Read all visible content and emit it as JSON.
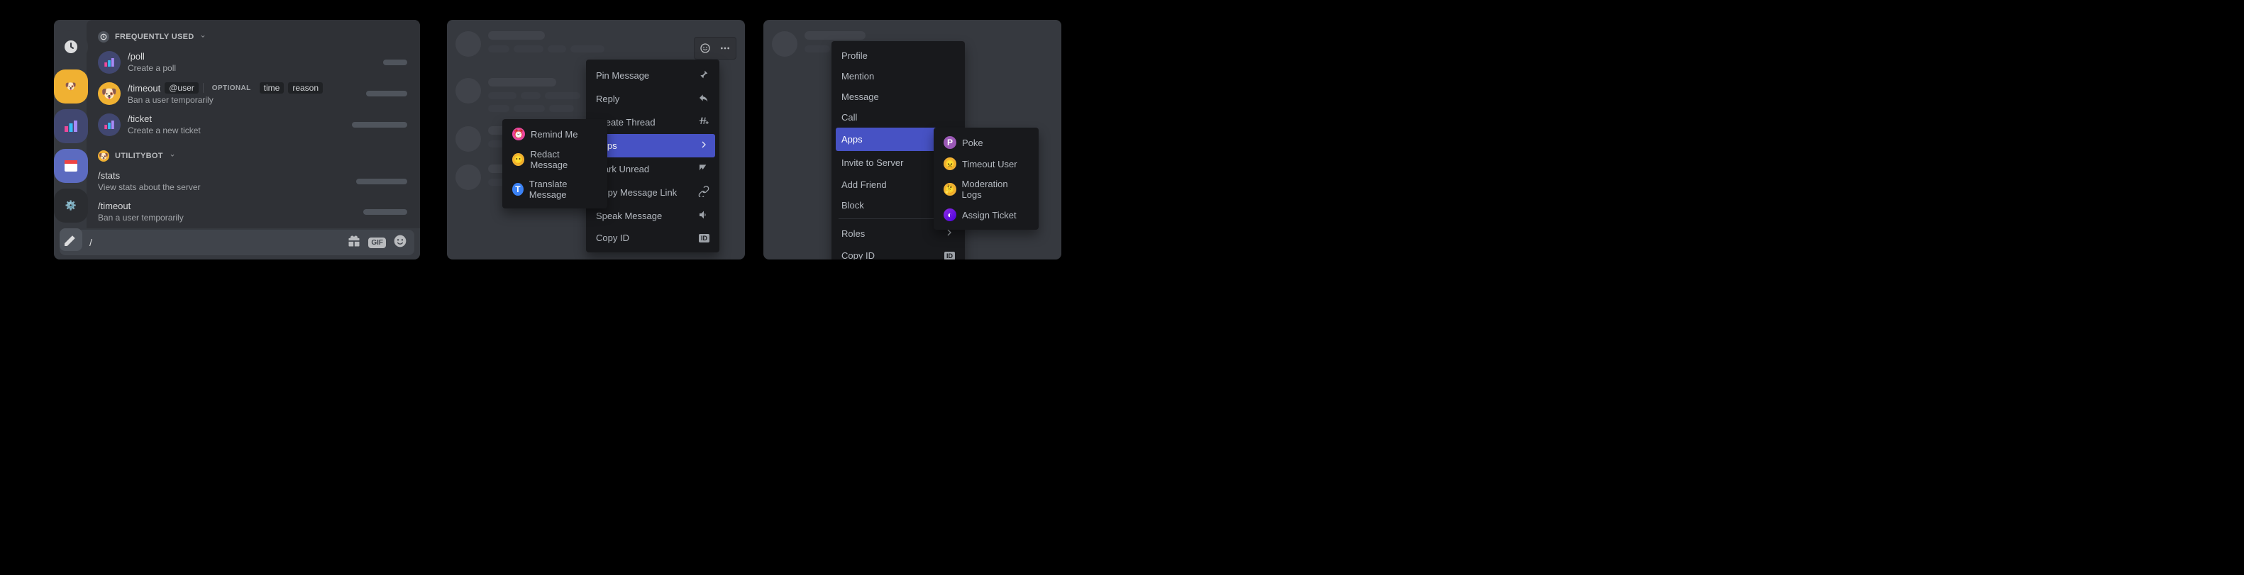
{
  "panel1": {
    "server_rail": [
      "clock",
      "dog",
      "chart",
      "window",
      "gear",
      "pencil"
    ],
    "section1": {
      "header": "FREQUENTLY USED",
      "commands": [
        {
          "icon": "chart",
          "name": "/poll",
          "desc": "Create a poll"
        },
        {
          "icon": "dog",
          "name": "/timeout",
          "args": [
            "@user"
          ],
          "optional_label": "OPTIONAL",
          "optional": [
            "time",
            "reason"
          ],
          "desc": "Ban a user temporarily"
        },
        {
          "icon": "chart",
          "name": "/ticket",
          "desc": "Create a new ticket"
        }
      ]
    },
    "section2": {
      "header": "UTILITYBOT",
      "commands": [
        {
          "name": "/stats",
          "desc": "View stats about the server"
        },
        {
          "name": "/timeout",
          "desc": "Ban a user temporarily"
        }
      ]
    },
    "input": {
      "value": "/",
      "right_icons": [
        "gift",
        "gif",
        "emoji"
      ],
      "gif_label": "GIF"
    }
  },
  "panel2": {
    "hover_icons": [
      "emoji",
      "more"
    ],
    "context_menu": [
      {
        "label": "Pin Message",
        "icon": "pin"
      },
      {
        "label": "Reply",
        "icon": "reply"
      },
      {
        "label": "Create Thread",
        "icon": "thread"
      },
      {
        "label": "Apps",
        "icon": "chevron",
        "hl": true
      },
      {
        "label": "Mark Unread",
        "icon": "unread"
      },
      {
        "label": "Copy Message Link",
        "icon": "link"
      },
      {
        "label": "Speak Message",
        "icon": "speak"
      },
      {
        "label": "Copy ID",
        "icon": "id"
      }
    ],
    "apps_submenu": [
      {
        "icon": "pink",
        "label": "Remind Me"
      },
      {
        "icon": "orange",
        "label": "Redact Message"
      },
      {
        "icon": "blue",
        "label": "Translate Message"
      }
    ]
  },
  "panel3": {
    "context_menu": [
      {
        "label": "Profile"
      },
      {
        "label": "Mention"
      },
      {
        "label": "Message"
      },
      {
        "label": "Call"
      },
      {
        "label": "Apps",
        "icon": "chevron",
        "hl": true
      },
      {
        "label": "Invite to Server",
        "icon": "chevron"
      },
      {
        "label": "Add Friend"
      },
      {
        "label": "Block"
      },
      {
        "label": "Roles",
        "icon": "chevron"
      },
      {
        "label": "Copy ID",
        "icon": "id"
      }
    ],
    "apps_submenu": [
      {
        "icon": "purple",
        "label": "Poke"
      },
      {
        "icon": "orange",
        "label": "Timeout User"
      },
      {
        "icon": "orange",
        "label": "Moderation Logs"
      },
      {
        "icon": "gradient",
        "label": "Assign Ticket"
      }
    ]
  }
}
